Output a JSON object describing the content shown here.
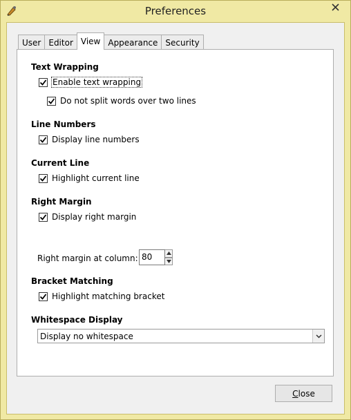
{
  "window": {
    "title": "Preferences"
  },
  "tabs": [
    {
      "label": "User",
      "active": false
    },
    {
      "label": "Editor",
      "active": false
    },
    {
      "label": "View",
      "active": true
    },
    {
      "label": "Appearance",
      "active": false
    },
    {
      "label": "Security",
      "active": false
    }
  ],
  "sections": {
    "text_wrapping": {
      "title": "Text Wrapping",
      "enable_label": "Enable text wrapping",
      "enable_checked": true,
      "no_split_label": "Do not split words over two lines",
      "no_split_checked": true
    },
    "line_numbers": {
      "title": "Line Numbers",
      "display_label": "Display line numbers",
      "display_checked": true
    },
    "current_line": {
      "title": "Current Line",
      "highlight_label": "Highlight current line",
      "highlight_checked": true
    },
    "right_margin": {
      "title": "Right Margin",
      "display_label": "Display right margin",
      "display_checked": true,
      "column_label": "Right margin at column:",
      "column_value": "80"
    },
    "bracket_matching": {
      "title": "Bracket Matching",
      "highlight_label": "Highlight matching bracket",
      "highlight_checked": true
    },
    "whitespace_display": {
      "title": "Whitespace Display",
      "selected": "Display no whitespace"
    }
  },
  "buttons": {
    "close_first": "C",
    "close_rest": "lose"
  },
  "icons": {
    "app": "pen-icon",
    "window_close": "close-icon",
    "check": "check-icon",
    "spin_up": "triangle-up-icon",
    "spin_down": "triangle-down-icon",
    "dropdown": "chevron-down-icon"
  }
}
